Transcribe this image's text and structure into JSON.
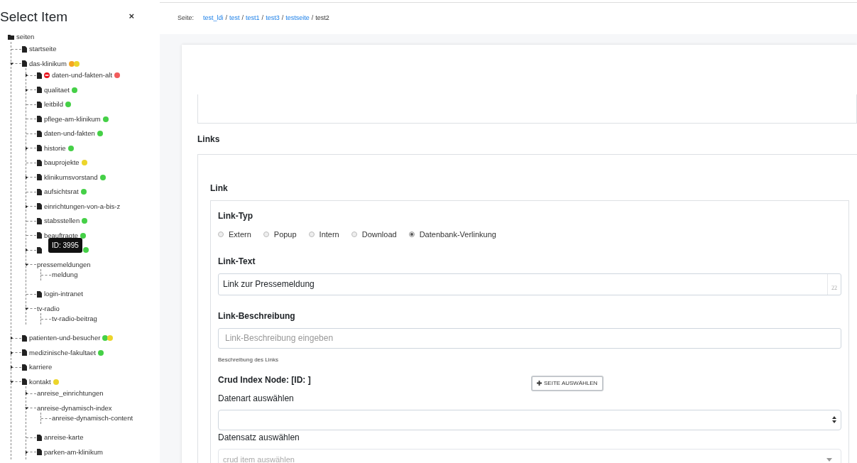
{
  "panel": {
    "title": "Select Item",
    "close": "×"
  },
  "tree": {
    "label": "seiten",
    "kind": "folder",
    "children": [
      {
        "label": "startseite",
        "kind": "file"
      },
      {
        "label": "das-klinikum",
        "kind": "file",
        "expanded": true,
        "dots": [
          {
            "color": "#f5a623"
          },
          {
            "color": "#ecd52b"
          }
        ],
        "children": [
          {
            "label": "daten-und-fakten-alt",
            "kind": "file",
            "expanded": false,
            "blocked": true,
            "dots": [
              {
                "color": "#f25c5c"
              }
            ]
          },
          {
            "label": "qualitaet",
            "kind": "file",
            "expanded": false,
            "dots": [
              {
                "color": "#45d047"
              }
            ]
          },
          {
            "label": "leitbild",
            "kind": "file",
            "dots": [
              {
                "color": "#45d047"
              }
            ]
          },
          {
            "label": "pflege-am-klinikum",
            "kind": "file",
            "dots": [
              {
                "color": "#45d047"
              }
            ]
          },
          {
            "label": "daten-und-fakten",
            "kind": "file",
            "dots": [
              {
                "color": "#45d047"
              }
            ]
          },
          {
            "label": "historie",
            "kind": "file",
            "expanded": false,
            "dots": [
              {
                "color": "#45d047"
              }
            ]
          },
          {
            "label": "bauprojekte",
            "kind": "file",
            "dots": [
              {
                "color": "#ecd52b"
              }
            ]
          },
          {
            "label": "klinikumsvorstand",
            "kind": "file",
            "expanded": false,
            "dots": [
              {
                "color": "#45d047"
              }
            ]
          },
          {
            "label": "aufsichtsrat",
            "kind": "file",
            "dots": [
              {
                "color": "#45d047"
              }
            ]
          },
          {
            "label": "einrichtungen-von-a-bis-z",
            "kind": "file",
            "expanded": false
          },
          {
            "label": "stabsstellen",
            "kind": "file",
            "dots": [
              {
                "color": "#45d047"
              }
            ]
          },
          {
            "label": "beauftragte",
            "kind": "file",
            "dots": [
              {
                "color": "#45d047"
              }
            ]
          },
          {
            "kind": "file",
            "expanded": false,
            "tooltip": "ID: 3995",
            "dots": [
              {
                "color": "#45d047"
              }
            ]
          },
          {
            "label": "pressemeldungen",
            "kind": "plain",
            "expanded": true,
            "children": [
              {
                "label": "meldung"
              }
            ]
          },
          {
            "label": "login-intranet",
            "kind": "file"
          },
          {
            "label": "tv-radio",
            "kind": "plain",
            "expanded": true,
            "children": [
              {
                "label": "tv-radio-beitrag"
              }
            ]
          }
        ]
      },
      {
        "label": "patienten-und-besucher",
        "kind": "file",
        "expanded": false,
        "dots": [
          {
            "color": "#45d047"
          },
          {
            "color": "#ecd52b"
          }
        ]
      },
      {
        "label": "medizinische-fakultaet",
        "kind": "file",
        "expanded": false,
        "dots": [
          {
            "color": "#45d047"
          }
        ]
      },
      {
        "label": "karriere",
        "kind": "file",
        "expanded": false
      },
      {
        "label": "kontakt",
        "kind": "file",
        "expanded": true,
        "dots": [
          {
            "color": "#ecd52b"
          }
        ],
        "children": [
          {
            "label": "anreise_einrichtungen",
            "kind": "plain",
            "expanded": false
          },
          {
            "label": "anreise-dynamisch-index",
            "kind": "plain",
            "expanded": true,
            "children": [
              {
                "label": "anreise-dynamisch-content"
              }
            ]
          },
          {
            "label": "anreise-karte",
            "kind": "file"
          },
          {
            "label": "parken-am-klinikum",
            "kind": "file",
            "expanded": false
          }
        ]
      }
    ]
  },
  "breadcrumb": {
    "label": "Seite:",
    "links": [
      "test_ldi",
      "test",
      "test1",
      "test3",
      "testseite"
    ],
    "separators": [
      "/",
      "/",
      "/",
      "/",
      "/"
    ],
    "current": "test2"
  },
  "section_title": "Links",
  "link": {
    "title": "Link",
    "type_label": "Link-Typ",
    "types": [
      {
        "label": "Extern",
        "selected": false
      },
      {
        "label": "Popup",
        "selected": false
      },
      {
        "label": "Intern",
        "selected": false
      },
      {
        "label": "Download",
        "selected": false
      },
      {
        "label": "Datenbank-Verlinkung",
        "selected": true
      }
    ],
    "text_label": "Link-Text",
    "text_value": "Link zur Pressemeldung",
    "text_counter": "22",
    "desc_label": "Link-Beschreibung",
    "desc_placeholder": "Link-Beschreibung eingeben",
    "desc_help": "Beschreibung des Links",
    "crud_label": "Crud Index Node: [ID: ]",
    "select_page_button": "SEITE AUSWÄHLEN",
    "datatype_label": "Datenart auswählen",
    "record_label": "Datensatz auswählen",
    "record_placeholder": "crud item auswählen"
  }
}
